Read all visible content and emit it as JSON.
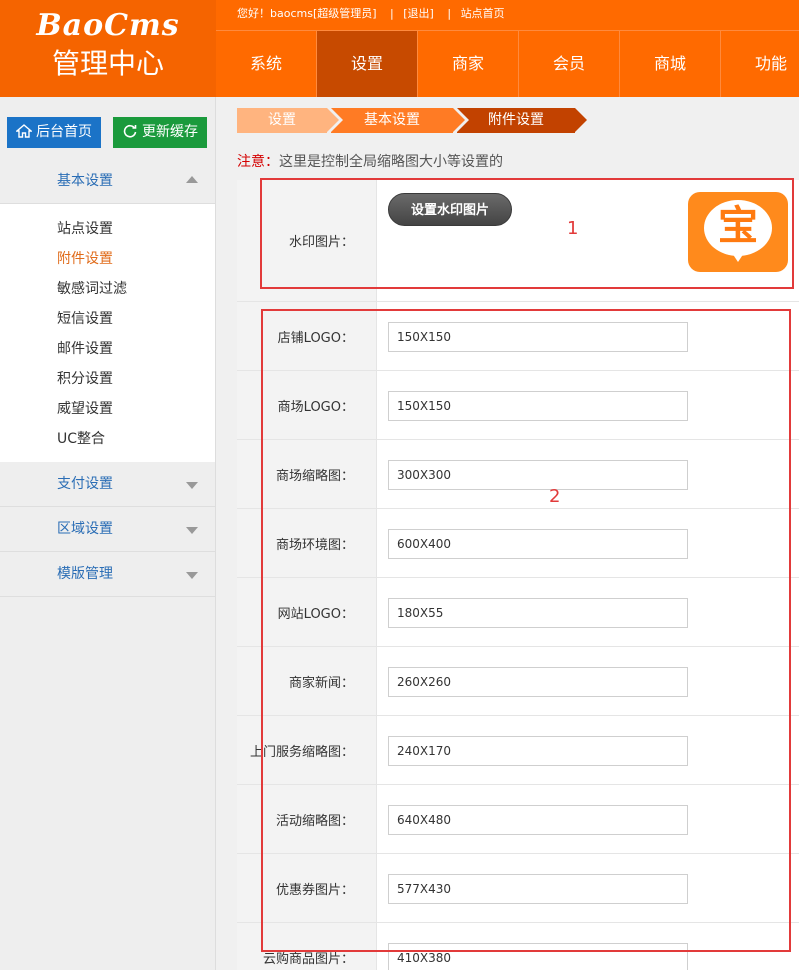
{
  "header": {
    "brand": "BaoCms",
    "subtitle": "管理中心",
    "greeting": "您好！baocms[超级管理员]",
    "logout": "[退出]",
    "home_link": "站点首页",
    "nav": [
      {
        "label": "系统"
      },
      {
        "label": "设置"
      },
      {
        "label": "商家"
      },
      {
        "label": "会员"
      },
      {
        "label": "商城"
      },
      {
        "label": "功能"
      }
    ]
  },
  "sidebar": {
    "home_button": "后台首页",
    "cache_button": "更新缓存",
    "groups": [
      {
        "label": "基本设置"
      },
      {
        "label": "支付设置"
      },
      {
        "label": "区域设置"
      },
      {
        "label": "模版管理"
      }
    ],
    "basic_items": [
      {
        "label": "站点设置"
      },
      {
        "label": "附件设置"
      },
      {
        "label": "敏感词过滤"
      },
      {
        "label": "短信设置"
      },
      {
        "label": "邮件设置"
      },
      {
        "label": "积分设置"
      },
      {
        "label": "威望设置"
      },
      {
        "label": "UC整合"
      }
    ]
  },
  "breadcrumb": [
    "设置",
    "基本设置",
    "附件设置"
  ],
  "notice": {
    "label": "注意：",
    "text": "这里是控制全局缩略图大小等设置的"
  },
  "watermark": {
    "label": "水印图片：",
    "button": "设置水印图片",
    "image_char": "宝"
  },
  "rows": [
    {
      "label": "店铺LOGO：",
      "value": "150X150"
    },
    {
      "label": "商场LOGO：",
      "value": "150X150"
    },
    {
      "label": "商场缩略图：",
      "value": "300X300"
    },
    {
      "label": "商场环境图：",
      "value": "600X400"
    },
    {
      "label": "网站LOGO：",
      "value": "180X55"
    },
    {
      "label": "商家新闻：",
      "value": "260X260"
    },
    {
      "label": "上门服务缩略图：",
      "value": "240X170"
    },
    {
      "label": "活动缩略图：",
      "value": "640X480"
    },
    {
      "label": "优惠券图片：",
      "value": "577X430"
    },
    {
      "label": "云购商品图片：",
      "value": "410X380"
    }
  ],
  "annotations": {
    "box1": "1",
    "box2": "2"
  },
  "colors": {
    "header": "#ff6a00",
    "nav_active": "#c74a00",
    "home_btn": "#1b73c7",
    "cache_btn": "#1a9a3c",
    "highlight": "#e23a3a"
  }
}
